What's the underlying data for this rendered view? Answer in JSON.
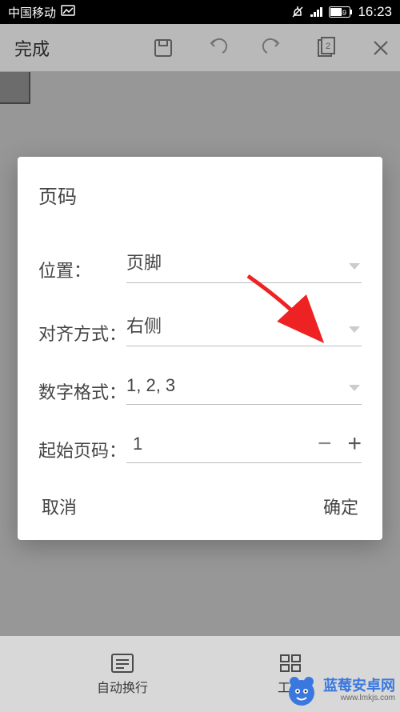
{
  "status_bar": {
    "carrier": "中国移动",
    "battery": "59",
    "time": "16:23"
  },
  "toolbar": {
    "done_label": "完成",
    "page_badge": "2"
  },
  "dialog": {
    "title": "页码",
    "rows": {
      "position": {
        "label": "位置：",
        "value": "页脚"
      },
      "align": {
        "label": "对齐方式：",
        "value": "右侧"
      },
      "format": {
        "label": "数字格式：",
        "value": "1, 2, 3"
      },
      "start": {
        "label": "起始页码：",
        "value": "1"
      }
    },
    "actions": {
      "cancel": "取消",
      "confirm": "确定"
    }
  },
  "bottom_nav": {
    "auto_wrap": "自动换行",
    "tools": "工具"
  },
  "watermark": {
    "brand": "蓝莓安卓网",
    "url": "www.lmkjs.com"
  }
}
